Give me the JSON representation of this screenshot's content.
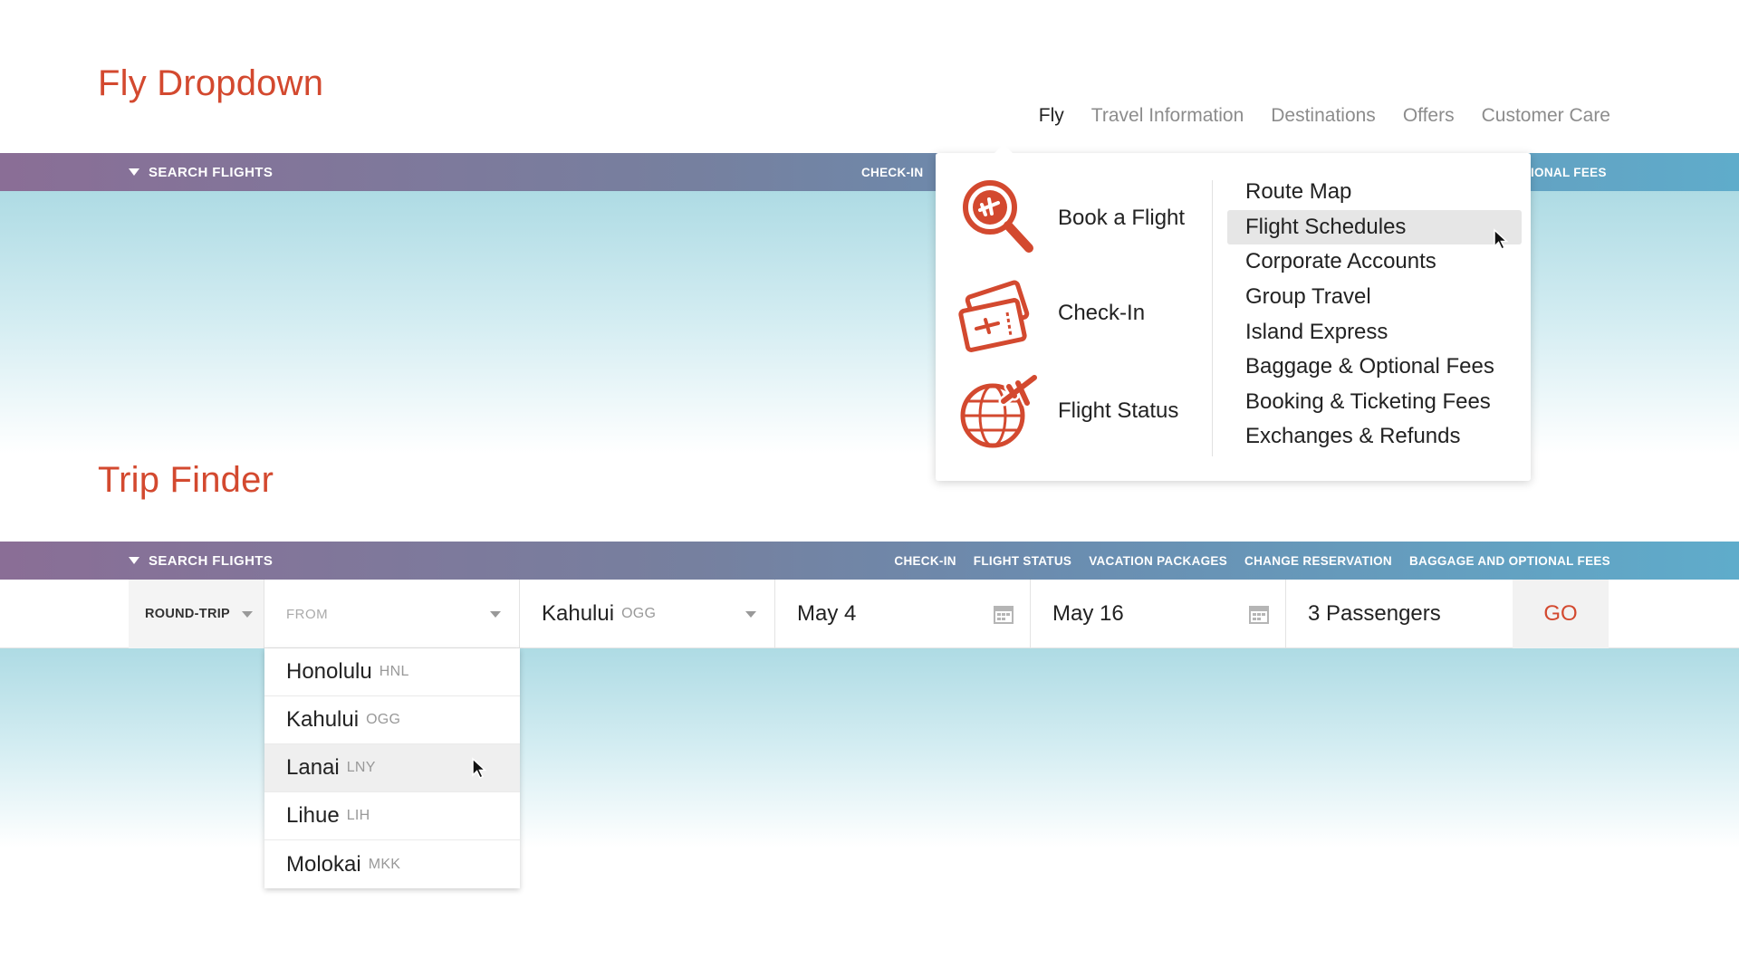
{
  "sections": {
    "fly_dropdown_title": "Fly Dropdown",
    "trip_finder_title": "Trip Finder"
  },
  "top_nav": [
    {
      "label": "Fly",
      "active": true
    },
    {
      "label": "Travel Information",
      "active": false
    },
    {
      "label": "Destinations",
      "active": false
    },
    {
      "label": "Offers",
      "active": false
    },
    {
      "label": "Customer Care",
      "active": false
    }
  ],
  "bar1": {
    "toggle_label": "SEARCH FLIGHTS",
    "checkin_label": "CHECK-IN",
    "visible_right_label": "IONAL FEES"
  },
  "bar2": {
    "toggle_label": "SEARCH FLIGHTS",
    "links": [
      "CHECK-IN",
      "FLIGHT STATUS",
      "VACATION PACKAGES",
      "CHANGE RESERVATION",
      "BAGGAGE AND OPTIONAL FEES"
    ]
  },
  "fly_menu": {
    "features": [
      {
        "label": "Book a Flight",
        "icon": "magnifier-plane-icon"
      },
      {
        "label": "Check-In",
        "icon": "boarding-pass-icon"
      },
      {
        "label": "Flight Status",
        "icon": "globe-plane-icon"
      }
    ],
    "links": [
      {
        "label": "Route Map",
        "hover": false
      },
      {
        "label": "Flight Schedules",
        "hover": true
      },
      {
        "label": "Corporate Accounts",
        "hover": false
      },
      {
        "label": "Group Travel",
        "hover": false
      },
      {
        "label": "Island Express",
        "hover": false
      },
      {
        "label": "Baggage & Optional Fees",
        "hover": false
      },
      {
        "label": "Booking & Ticketing Fees",
        "hover": false
      },
      {
        "label": "Exchanges & Refunds",
        "hover": false
      }
    ]
  },
  "trip_finder": {
    "trip_type": "ROUND-TRIP",
    "from_placeholder": "FROM",
    "to_city": "Kahului",
    "to_code": "OGG",
    "depart_date": "May 4",
    "return_date": "May 16",
    "passengers": "3 Passengers",
    "go_label": "GO"
  },
  "airport_options": [
    {
      "city": "Honolulu",
      "code": "HNL",
      "hover": false
    },
    {
      "city": "Kahului",
      "code": "OGG",
      "hover": false
    },
    {
      "city": "Lanai",
      "code": "LNY",
      "hover": true
    },
    {
      "city": "Lihue",
      "code": "LIH",
      "hover": false
    },
    {
      "city": "Molokai",
      "code": "MKK",
      "hover": false
    }
  ],
  "colors": {
    "accent_red": "#d3492f",
    "bar_gradient_start": "#8a6e96",
    "bar_gradient_end": "#5faccb"
  }
}
